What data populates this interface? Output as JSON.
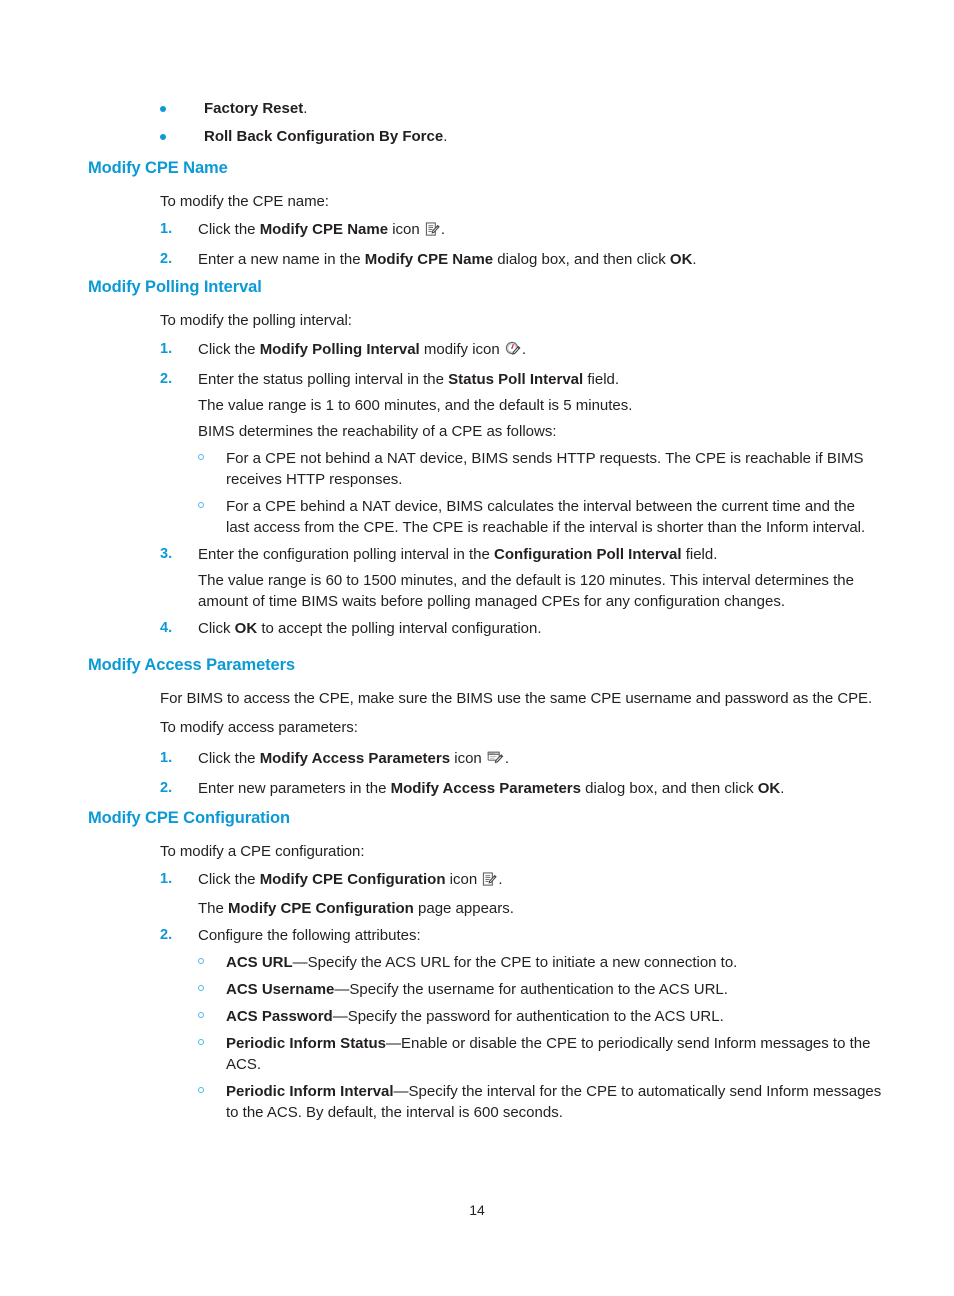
{
  "page": {
    "number": "14"
  },
  "theme": {
    "heading_color": "#0b9ad6",
    "bullet_color": "#0b9ad6",
    "subbullet_color": "#4fb8e3",
    "text_color": "#231f20"
  },
  "top_bullets": [
    {
      "bold": "Factory Reset",
      "rest": "."
    },
    {
      "bold": "Roll Back Configuration By Force",
      "rest": "."
    }
  ],
  "sections": [
    {
      "id": "modify-cpe-name",
      "heading": "Modify CPE Name",
      "intro": "To modify the CPE name:",
      "steps": [
        {
          "num": "1.",
          "pre": "Click the ",
          "bold": "Modify CPE Name",
          "post": " icon ",
          "icon": "document-pencil-icon",
          "tail": "."
        },
        {
          "num": "2.",
          "pre": "Enter a new name in the ",
          "bold": "Modify CPE Name",
          "post": " dialog box, and then click ",
          "bold2": "OK",
          "tail": "."
        }
      ]
    },
    {
      "id": "modify-polling-interval",
      "heading": "Modify Polling Interval",
      "intro": "To modify the polling interval:",
      "steps": [
        {
          "num": "1.",
          "pre": "Click the ",
          "bold": "Modify Polling Interval",
          "post": " modify icon ",
          "icon": "clock-pencil-icon",
          "tail": "."
        },
        {
          "num": "2.",
          "pre": "Enter the status polling interval in the ",
          "bold": "Status Poll Interval",
          "post": " field.",
          "paragraphs": [
            "The value range is 1 to 600 minutes, and the default is 5 minutes.",
            "BIMS determines the reachability of a CPE as follows:"
          ],
          "subbullets": [
            "For a CPE not behind a NAT device, BIMS sends HTTP requests. The CPE is reachable if BIMS receives HTTP responses.",
            "For a CPE behind a NAT device, BIMS calculates the interval between the current time and the last access from the CPE. The CPE is reachable if the interval is shorter than the Inform interval."
          ]
        },
        {
          "num": "3.",
          "pre": "Enter the configuration polling interval in the ",
          "bold": "Configuration Poll Interval",
          "post": " field.",
          "paragraphs": [
            "The value range is 60 to 1500 minutes, and the default is 120 minutes. This interval determines the amount of time BIMS waits before polling managed CPEs for any configuration changes."
          ]
        },
        {
          "num": "4.",
          "pre": "Click ",
          "bold": "OK",
          "post": " to accept the polling interval configuration."
        }
      ]
    },
    {
      "id": "modify-access-parameters",
      "heading": "Modify Access Parameters",
      "lead": "For BIMS to access the CPE, make sure the BIMS use the same CPE username and password as the CPE.",
      "intro": "To modify access parameters:",
      "steps": [
        {
          "num": "1.",
          "pre": "Click the ",
          "bold": "Modify Access Parameters",
          "post": " icon ",
          "icon": "dialog-pencil-icon",
          "tail": "."
        },
        {
          "num": "2.",
          "pre": "Enter new parameters in the ",
          "bold": "Modify Access Parameters",
          "post": " dialog box, and then click ",
          "bold2": "OK",
          "tail": "."
        }
      ]
    },
    {
      "id": "modify-cpe-configuration",
      "heading": "Modify CPE Configuration",
      "intro": "To modify a CPE configuration:",
      "steps": [
        {
          "num": "1.",
          "pre": "Click the ",
          "bold": "Modify CPE Configuration",
          "post": " icon ",
          "icon": "document-pencil-icon",
          "tail": ".",
          "follow_pre": "The ",
          "follow_bold": "Modify CPE Configuration",
          "follow_post": " page appears."
        },
        {
          "num": "2.",
          "pre": "Configure the following attributes:",
          "attributes": [
            {
              "term": "ACS URL",
              "dash": "—",
              "desc": "Specify the ACS URL for the CPE to initiate a new connection to."
            },
            {
              "term": "ACS Username",
              "dash": "—",
              "desc": "Specify the username for authentication to the ACS URL."
            },
            {
              "term": "ACS Password",
              "dash": "—",
              "desc": "Specify the password for authentication to the ACS URL."
            },
            {
              "term": "Periodic Inform Status",
              "dash": "—",
              "desc": "Enable or disable the CPE to periodically send Inform messages to the ACS."
            },
            {
              "term": "Periodic Inform Interval",
              "dash": "—",
              "desc": "Specify the interval for the CPE to automatically send Inform messages to the ACS. By default, the interval is 600 seconds."
            }
          ]
        }
      ]
    }
  ]
}
